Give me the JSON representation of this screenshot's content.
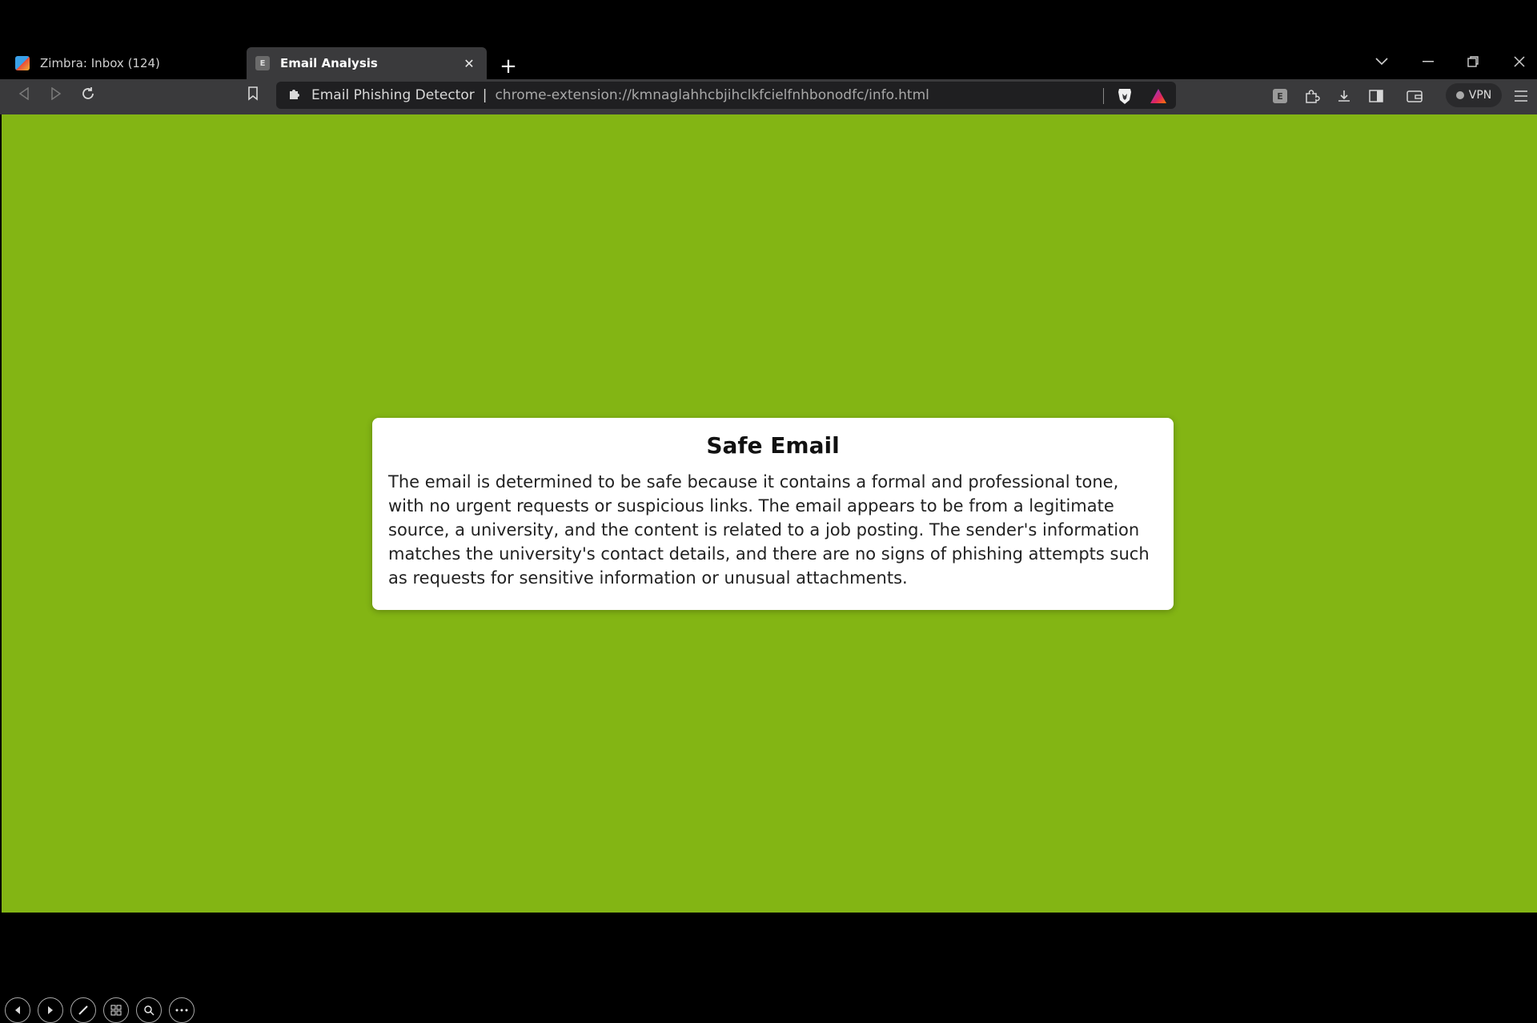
{
  "tabs": [
    {
      "title": "Zimbra: Inbox (124)",
      "icon": "zimbra-favicon-icon",
      "active": false
    },
    {
      "title": "Email Analysis",
      "icon": "extension-favicon-icon",
      "favicon_letter": "E",
      "active": true
    }
  ],
  "toolbar": {
    "site_name": "Email Phishing Detector",
    "separator": "|",
    "url": "chrome-extension://kmnaglahhcbjihclkfcielfnhbonodfc/info.html",
    "vpn_label": "VPN",
    "ext_letter": "E"
  },
  "card": {
    "title": "Safe Email",
    "body": "The email is determined to be safe because it contains a formal and professional tone, with no urgent requests or suspicious links. The email appears to be from a legitimate source, a university, and the content is related to a job posting. The sender's information matches the university's contact details, and there are no signs of phishing attempts such as requests for sensitive information or unusual attachments."
  },
  "colors": {
    "background": "#83b514",
    "card": "#ffffff",
    "chrome_dark": "#000000",
    "toolbar": "#3a3a3c"
  }
}
